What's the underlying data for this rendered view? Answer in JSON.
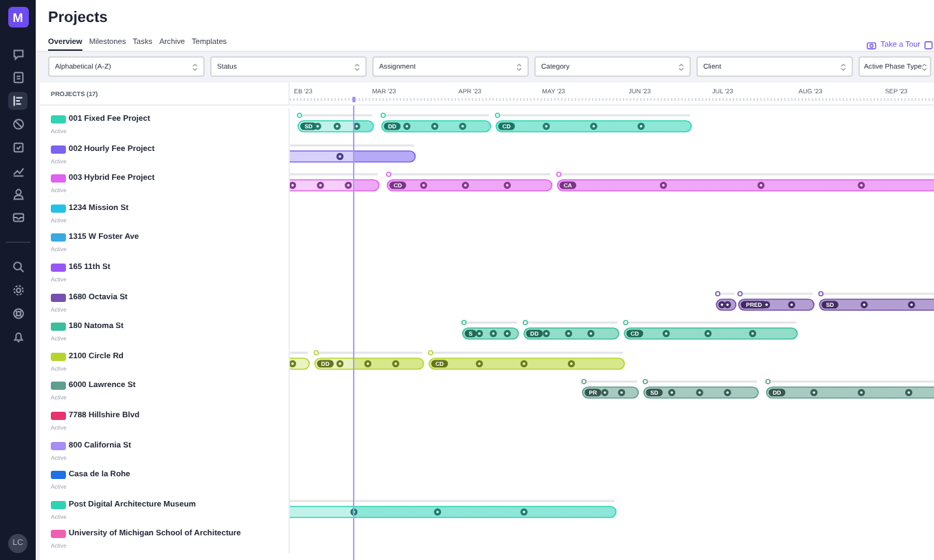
{
  "sidebar": {
    "logo": "M",
    "items": [
      {
        "selected": false
      },
      {
        "selected": false
      },
      {
        "selected": true
      },
      {
        "selected": false
      },
      {
        "selected": false
      },
      {
        "selected": false
      },
      {
        "selected": false
      },
      {
        "selected": false
      }
    ],
    "bottom_items": [
      {
        "selected": false
      },
      {
        "selected": false
      },
      {
        "selected": false
      },
      {
        "selected": false
      }
    ],
    "avatar": "LC"
  },
  "title": "Projects",
  "tabs": [
    {
      "label": "Overview",
      "selected": true
    },
    {
      "label": "Milestones",
      "selected": false
    },
    {
      "label": "Tasks",
      "selected": false
    },
    {
      "label": "Archive",
      "selected": false
    },
    {
      "label": "Templates",
      "selected": false
    }
  ],
  "tour_link": "Take a Tour",
  "filters": [
    {
      "label": "Alphabetical (A-Z)"
    },
    {
      "label": "Status"
    },
    {
      "label": "Assignment"
    },
    {
      "label": "Category"
    },
    {
      "label": "Client"
    },
    {
      "label": "Active Phase Type"
    }
  ],
  "table": {
    "header": "PROJECTS (17)",
    "months": [
      "EB '23",
      "MAR '23",
      "APR '23",
      "MAY '23",
      "JUN '23",
      "JUL '23",
      "AUG '23",
      "SEP '23"
    ],
    "rows": [
      {
        "name": "001 Fixed Fee Project",
        "status": "Active",
        "color": "#2fd4b4",
        "phase_labels": [
          "SD",
          "DD",
          "CD"
        ]
      },
      {
        "name": "002 Hourly Fee Project",
        "status": "Active",
        "color": "#7b63ee"
      },
      {
        "name": "003 Hybrid Fee Project",
        "status": "Active",
        "color": "#e060f0",
        "phase_labels": [
          "CD",
          "CA"
        ]
      },
      {
        "name": "1234 Mission St",
        "status": "Active",
        "color": "#22c1e6"
      },
      {
        "name": "1315 W Foster Ave",
        "status": "Active",
        "color": "#3aa9e2"
      },
      {
        "name": "165 11th St",
        "status": "Active",
        "color": "#9a55f5"
      },
      {
        "name": "1680 Octavia St",
        "status": "Active",
        "color": "#7650b0",
        "phase_labels": [
          "PRED",
          "SD"
        ]
      },
      {
        "name": "180 Natoma St",
        "status": "Active",
        "color": "#3bbf9c",
        "phase_labels": [
          "S",
          "DD",
          "CD"
        ]
      },
      {
        "name": "2100 Circle Rd",
        "status": "Active",
        "color": "#b6d42e",
        "phase_labels": [
          "DD",
          "CD"
        ]
      },
      {
        "name": "6000 Lawrence St",
        "status": "Active",
        "color": "#5e9e8d",
        "phase_labels": [
          "PR",
          "SD",
          "DD"
        ]
      },
      {
        "name": "7788 Hillshire Blvd",
        "status": "Active",
        "color": "#e8336e"
      },
      {
        "name": "800 California St",
        "status": "Active",
        "color": "#a68cf5"
      },
      {
        "name": "Casa de la Rohe",
        "status": "Active",
        "color": "#1f6fe6"
      },
      {
        "name": "Post Digital Architecture Museum",
        "status": "Active",
        "color": "#30d2b6"
      },
      {
        "name": "University of Michigan School of Architecture",
        "status": "Active",
        "color": "#f060b2"
      }
    ]
  }
}
